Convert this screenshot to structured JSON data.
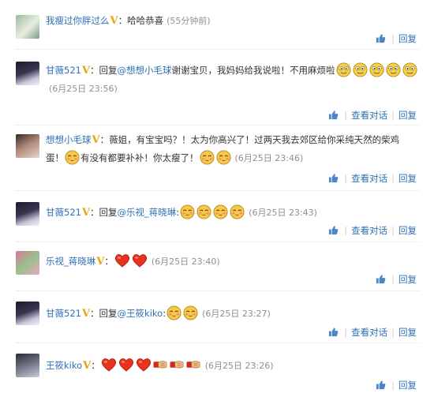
{
  "comments": [
    {
      "user": "我瘦过你胖过么",
      "badge": "V",
      "colon": "：",
      "body": "哈哈恭喜",
      "time": "(55分钟前)",
      "reply_label": "回复"
    },
    {
      "user": "甘薇521",
      "badge": "V",
      "colon": "：",
      "reply_prefix": "回复",
      "mention": "@想想小毛球",
      "body": "谢谢宝贝，我妈妈给我说啦！不用麻烦啦",
      "time": "(6月25日 23:56)",
      "view_dialog_label": "查看对话",
      "reply_label": "回复"
    },
    {
      "user": "想想小毛球",
      "badge": "V",
      "colon": "：",
      "body1": "薇姐，有宝宝吗？！太为你高兴了！过两天我去郊区给你采纯天然的柴鸡蛋！",
      "body2": "有没有都要补补！你太瘦了！",
      "time": "(6月25日 23:46)",
      "view_dialog_label": "查看对话",
      "reply_label": "回复"
    },
    {
      "user": "甘薇521",
      "badge": "V",
      "colon": "：",
      "reply_prefix": "回复",
      "mention": "@乐视_蒋晓琳",
      "mention_colon": ":",
      "time": "(6月25日 23:43)",
      "view_dialog_label": "查看对话",
      "reply_label": "回复"
    },
    {
      "user": "乐视_蒋晓琳",
      "badge": "V",
      "colon": "：",
      "time": "(6月25日 23:40)",
      "reply_label": "回复"
    },
    {
      "user": "甘薇521",
      "badge": "V",
      "colon": "：",
      "reply_prefix": "回复",
      "mention": "@王筱kiko",
      "mention_colon": ":",
      "time": "(6月25日 23:27)",
      "view_dialog_label": "查看对话",
      "reply_label": "回复"
    },
    {
      "user": "王筱kiko",
      "badge": "V",
      "colon": "：",
      "time": "(6月25日 23:26)",
      "reply_label": "回复"
    }
  ],
  "colors": {
    "link": "#2f6fb5",
    "badge": "#e8a20a",
    "time": "#8f8f8f"
  },
  "icons": [
    "thumbs-up-icon",
    "smiley-emoji-icon",
    "shy-emoji-icon",
    "heart-emoji-icon",
    "handshake-emoji-icon"
  ]
}
